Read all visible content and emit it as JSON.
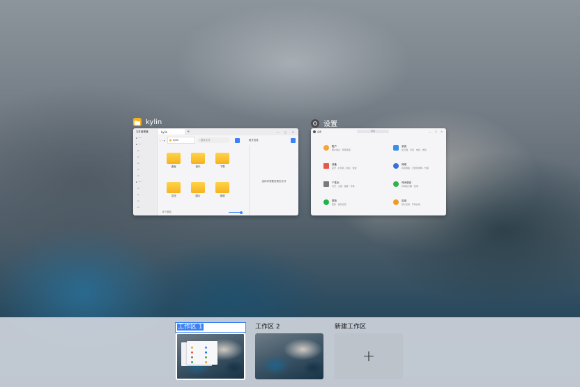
{
  "windows": [
    {
      "title": "kylin",
      "app": "file-manager",
      "sidebar_title": "文件管理器",
      "tab": "kylin",
      "path": "kylin",
      "search_placeholder": "搜索文件",
      "folders": [
        "桌面",
        "音乐",
        "下载",
        "文档",
        "图片",
        "视频"
      ],
      "detail_text": "选择你想要查看的文件",
      "status": "6个项目",
      "detail_header": "相关信息"
    },
    {
      "title": "设置",
      "app": "settings",
      "window_title": "设置",
      "search_placeholder": "搜索",
      "items": [
        {
          "title": "账户",
          "sub": "账户信息 · 登录选项",
          "icon_color": "#f4a630"
        },
        {
          "title": "系统",
          "sub": "显示器 · 声音 · 电源 · 通知",
          "icon_color": "#3b8ee8"
        },
        {
          "title": "设备",
          "sub": "蓝牙 · 打印机 · 鼠标 · 键盘",
          "icon_color": "#e35a4a"
        },
        {
          "title": "网络",
          "sub": "有线网络 · 无线局域网 · 代理",
          "icon_color": "#3b6fd6"
        },
        {
          "title": "个性化",
          "sub": "背景 · 主题 · 锁屏 · 字体",
          "icon_color": "#7a7a7a"
        },
        {
          "title": "时间语言",
          "sub": "时间和日期 · 区域",
          "icon_color": "#2fb24a"
        },
        {
          "title": "更新",
          "sub": "更新 · 备份还原",
          "icon_color": "#22b34a"
        },
        {
          "title": "应用",
          "sub": "默认应用 · 开机启动",
          "icon_color": "#f09a26"
        }
      ]
    }
  ],
  "workspaces": [
    {
      "label": "工作区 1",
      "selected": true
    },
    {
      "label": "工作区 2",
      "selected": false
    }
  ],
  "new_workspace": {
    "label": "新建工作区",
    "symbol": "+"
  }
}
